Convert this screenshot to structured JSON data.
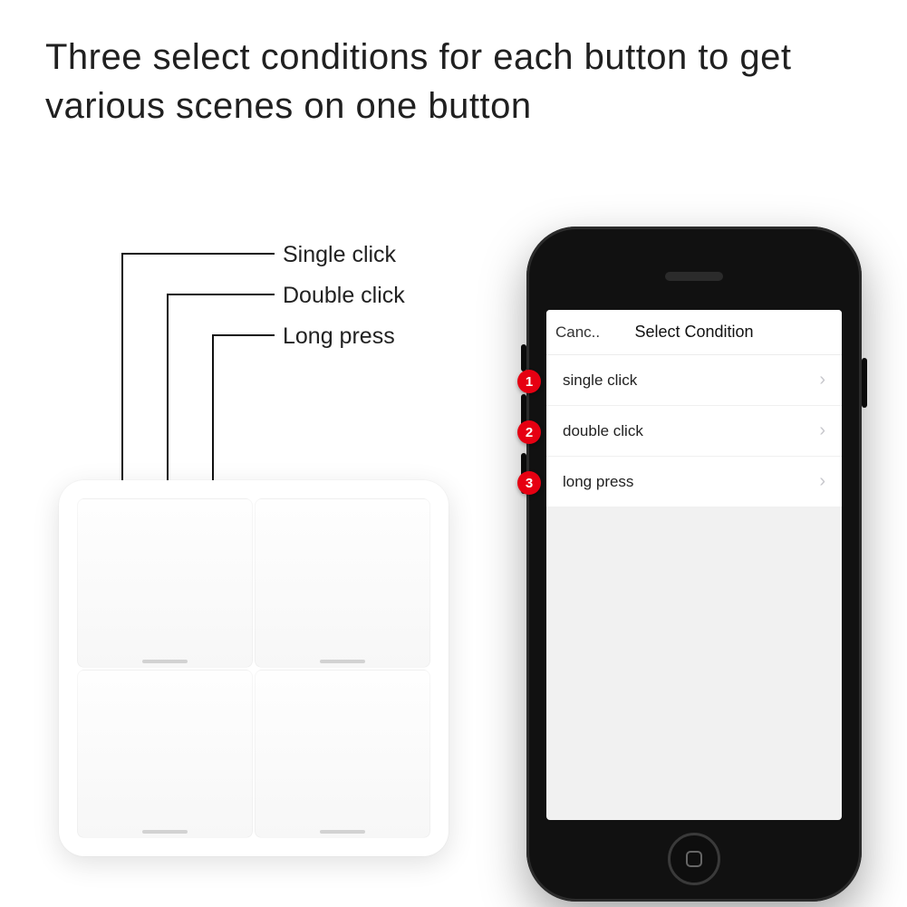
{
  "headline": "Three select conditions for each button to get various scenes on one button",
  "callouts": {
    "c1": "Single click",
    "c2": "Double click",
    "c3": "Long press"
  },
  "phone": {
    "cancel": "Canc..",
    "title": "Select Condition",
    "rows": {
      "r1": "single click",
      "r2": "double click",
      "r3": "long press"
    },
    "badges": {
      "b1": "1",
      "b2": "2",
      "b3": "3"
    }
  }
}
